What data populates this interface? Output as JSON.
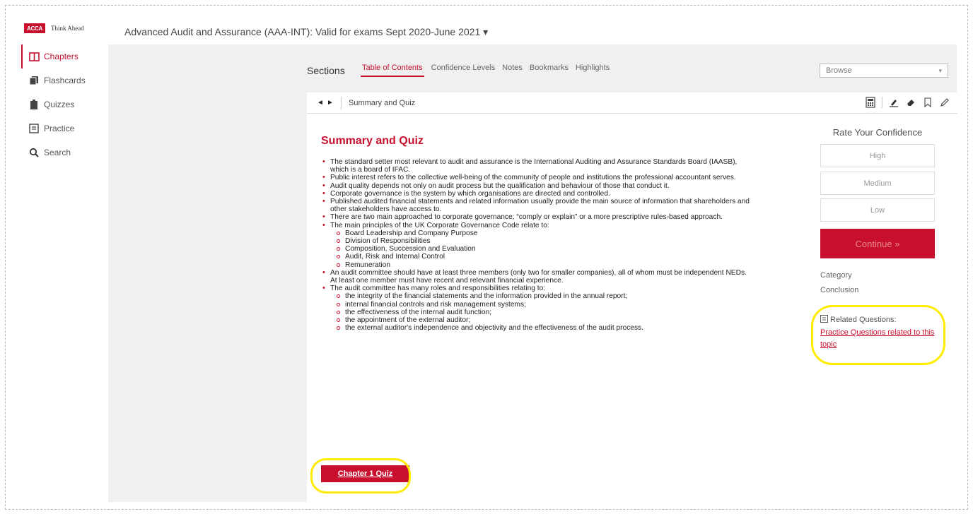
{
  "brand": {
    "logo_mark": "ACCA",
    "logo_tagline": "Think Ahead"
  },
  "course": {
    "title": "Advanced Audit and Assurance (AAA-INT): Valid for exams Sept 2020-June 2021 ▾"
  },
  "sidebar": {
    "items": [
      {
        "label": "Chapters",
        "icon": "book-open-icon",
        "active": true
      },
      {
        "label": "Flashcards",
        "icon": "flashcards-icon",
        "active": false
      },
      {
        "label": "Quizzes",
        "icon": "clipboard-icon",
        "active": false
      },
      {
        "label": "Practice",
        "icon": "practice-doc-icon",
        "active": false
      },
      {
        "label": "Search",
        "icon": "search-icon",
        "active": false
      }
    ]
  },
  "sections": {
    "label": "Sections",
    "tabs": [
      "Table of Contents",
      "Confidence Levels",
      "Notes",
      "Bookmarks",
      "Highlights"
    ],
    "active_tab": "Table of Contents",
    "browse": {
      "value": "Browse",
      "arrow": "▾"
    }
  },
  "toolbar": {
    "prev": "◄",
    "next": "►",
    "title": "Summary and Quiz",
    "icons": [
      "calculator-icon",
      "highlighter-icon",
      "eraser-icon",
      "bookmark-icon",
      "pencil-icon"
    ]
  },
  "article": {
    "heading": "Summary and Quiz",
    "bullets": [
      "The standard setter most relevant to audit and assurance is the International Auditing and Assurance Standards Board (IAASB), which is a board of IFAC.",
      "Public interest refers to the collective well-being of the community of people and institutions the professional accountant serves.",
      "Audit quality depends not only on audit process but the qualification and behaviour of those that conduct it.",
      "Corporate governance is the system by which organisations are directed and controlled.",
      "Published audited financial statements and related information usually provide the main source of information that shareholders and other stakeholders have access to.",
      "There are two main approached to corporate governance; “comply or explain” or a more prescriptive rules-based approach.",
      "The main principles of the UK Corporate Governance Code relate to:",
      "An audit committee should have at least three members (only two for smaller companies), all of whom must be independent NEDs. At least one member must have recent and relevant financial experience.",
      "The audit committee has many roles and responsibilities relating to:"
    ],
    "principles": [
      "Board Leadership and Company Purpose",
      "Division of Responsibilities",
      "Composition, Succession and Evaluation",
      "Audit, Risk and Internal Control",
      "Remuneration"
    ],
    "responsibilities": [
      "the integrity of the financial statements and the information provided in the annual report;",
      "internal financial controls and risk management systems;",
      "the effectiveness of the internal audit function;",
      "the appointment of the external auditor;",
      "the external auditor's independence and objectivity and the effectiveness of the audit process."
    ],
    "quiz_button": "Chapter 1 Quiz"
  },
  "confidence": {
    "title": "Rate Your Confidence",
    "high": "High",
    "medium": "Medium",
    "low": "Low",
    "continue": "Continue »"
  },
  "meta": {
    "category": "Category",
    "conclusion": "Conclusion"
  },
  "related": {
    "label": "Related Questions:",
    "link": "Practice Questions related to this topic"
  },
  "colors": {
    "accent": "#c8102e",
    "highlight_ring": "#ffec00",
    "panel_bg": "#f0f0f0"
  }
}
